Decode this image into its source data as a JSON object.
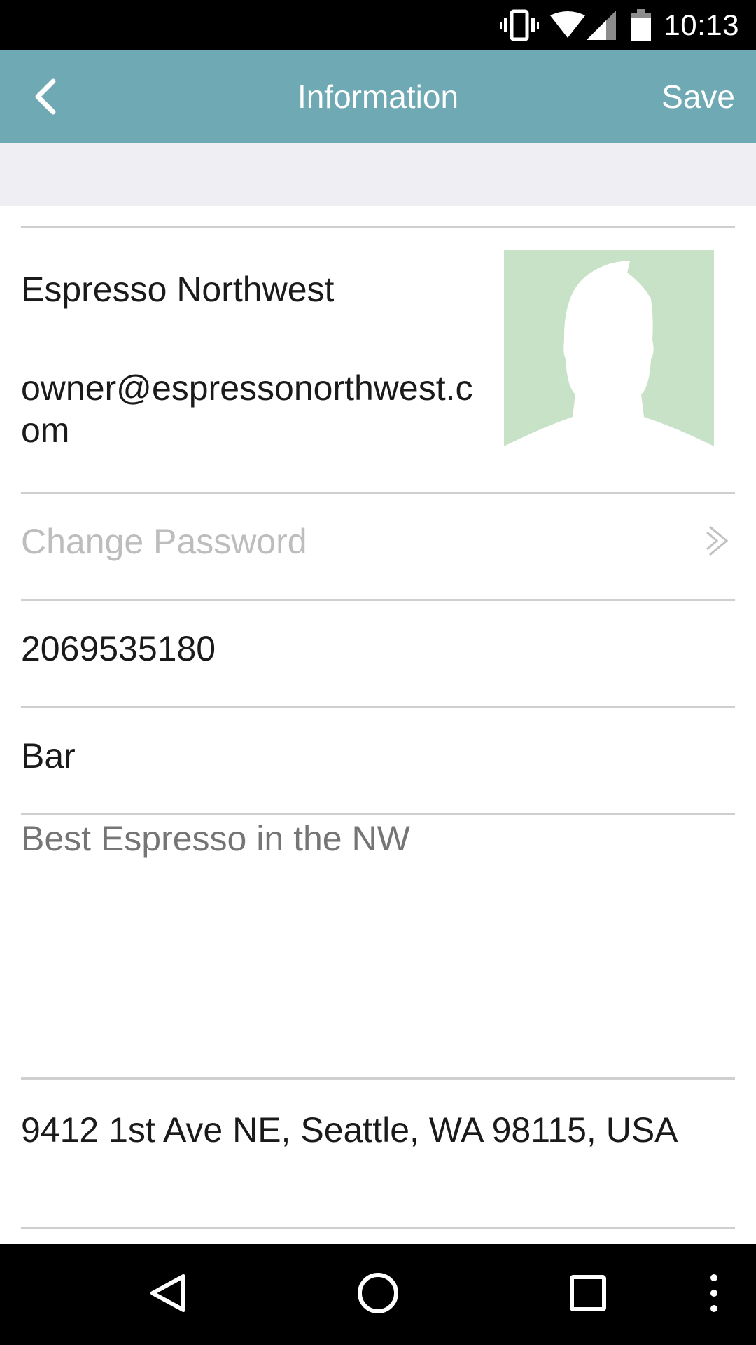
{
  "status_bar": {
    "time": "10:13",
    "icons": [
      "vibrate-icon",
      "wifi-icon",
      "signal-icon",
      "battery-icon"
    ]
  },
  "app_bar": {
    "title": "Information",
    "save_label": "Save",
    "back_icon": "chevron-left-icon",
    "color": "#6fa9b4"
  },
  "profile": {
    "business_name": "Espresso Northwest",
    "email": "owner@espressonorthwest.com",
    "avatar_icon": "person-silhouette-icon",
    "avatar_bg": "#c8e2c8"
  },
  "fields": {
    "change_password_label": "Change Password",
    "phone": "2069535180",
    "category": "Bar",
    "description_placeholder": "Best Espresso in the NW",
    "address": "9412 1st Ave NE, Seattle, WA 98115, USA"
  },
  "nav_bar": {
    "icons": [
      "back-triangle-icon",
      "home-circle-icon",
      "recents-square-icon",
      "overflow-menu-icon"
    ]
  }
}
